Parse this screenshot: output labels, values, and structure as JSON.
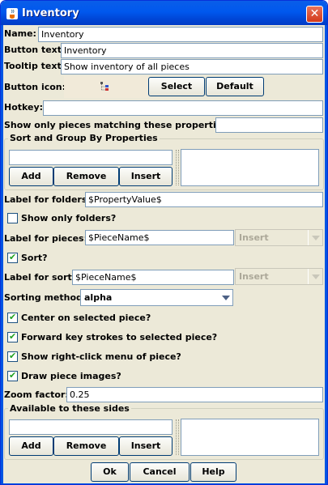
{
  "window": {
    "title": "Inventory",
    "close_glyph": "✕"
  },
  "fields": {
    "name": {
      "label": "Name:",
      "value": "Inventory"
    },
    "button_text": {
      "label": "Button text:",
      "value": "Inventory"
    },
    "tooltip_text": {
      "label": "Tooltip text:",
      "value": "Show inventory of all pieces"
    },
    "button_icon": {
      "label": "Button icon:",
      "select_label": "Select",
      "default_label": "Default",
      "icon": "tree-node-icon"
    },
    "hotkey": {
      "label": "Hotkey:",
      "value": ""
    },
    "filter": {
      "label": "Show only pieces matching these properties:",
      "value": ""
    }
  },
  "sort_group": {
    "title": "Sort and Group By Properties",
    "input_value": "",
    "add_label": "Add",
    "remove_label": "Remove",
    "insert_label": "Insert"
  },
  "folders": {
    "label": "Label for folders:",
    "value": "$PropertyValue$",
    "show_only_label": "Show only folders?",
    "show_only_checked": false
  },
  "pieces": {
    "label": "Label for pieces:",
    "value": "$PieceName$",
    "insert_label": "Insert"
  },
  "sort": {
    "label": "Sort?",
    "checked": true
  },
  "sort_label": {
    "label": "Label for sort:",
    "value": "$PieceName$",
    "insert_label": "Insert"
  },
  "sorting_method": {
    "label": "Sorting method:",
    "value": "alpha"
  },
  "options": [
    {
      "label": "Center on selected piece?",
      "checked": true
    },
    {
      "label": "Forward key strokes to selected piece?",
      "checked": true
    },
    {
      "label": "Show right-click menu of piece?",
      "checked": true
    },
    {
      "label": "Draw piece images?",
      "checked": true
    }
  ],
  "zoom": {
    "label": "Zoom factor:",
    "value": "0.25"
  },
  "sides": {
    "title": "Available to these sides",
    "input_value": "",
    "add_label": "Add",
    "remove_label": "Remove",
    "insert_label": "Insert"
  },
  "footer": {
    "ok_label": "Ok",
    "cancel_label": "Cancel",
    "help_label": "Help"
  },
  "colors": {
    "title_bar": "#0054e3",
    "dialog_bg": "#ece9d8",
    "check_green": "#21a121"
  }
}
